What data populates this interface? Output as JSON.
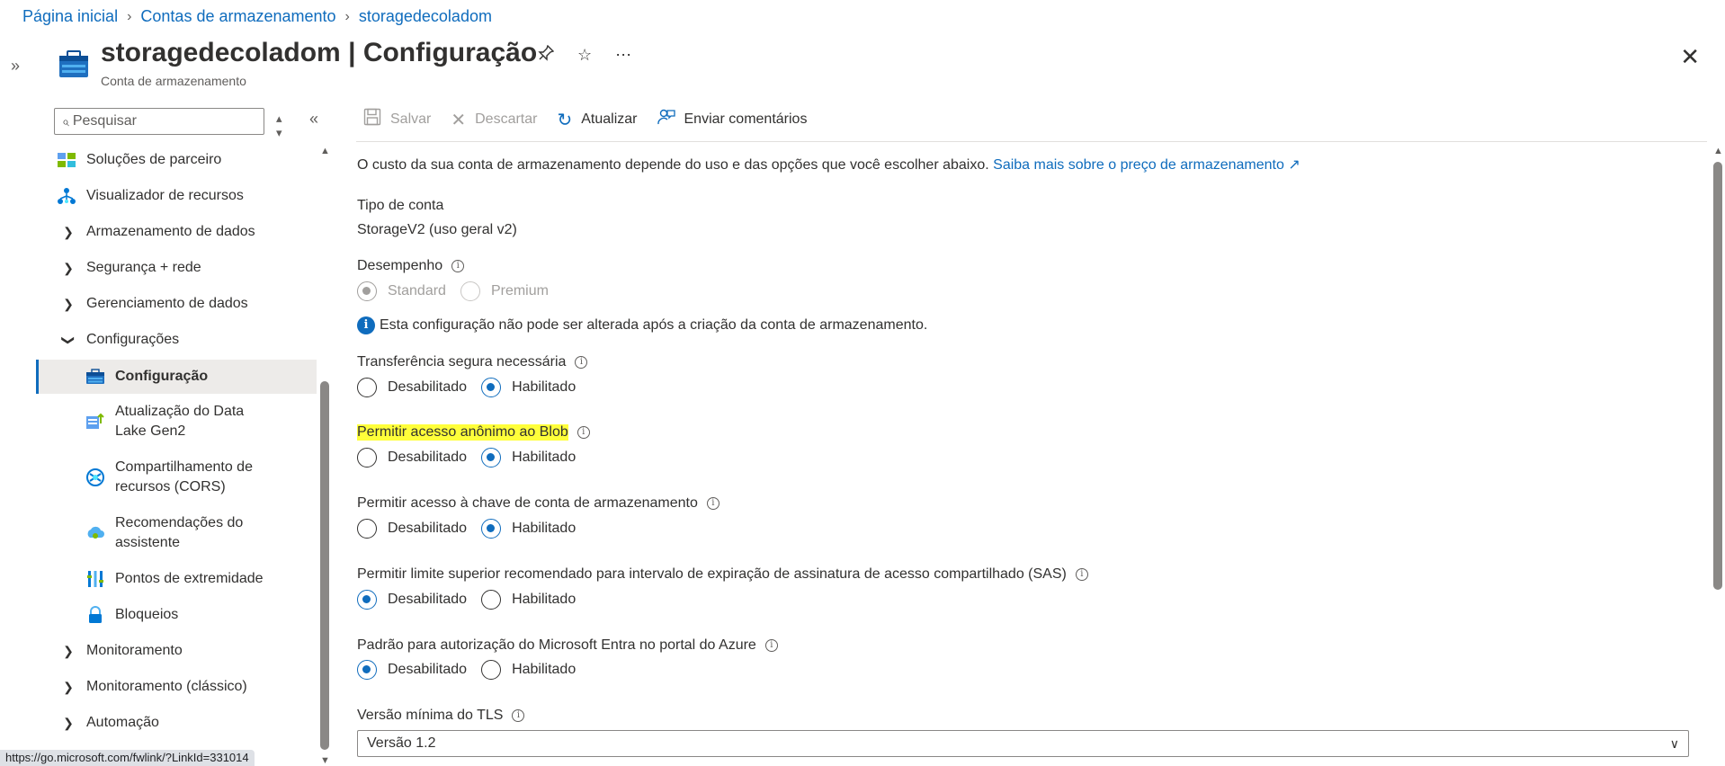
{
  "breadcrumb": [
    "Página inicial",
    "Contas de armazenamento",
    "storagedecoladom"
  ],
  "header": {
    "resource_name": "storagedecoladom",
    "separator": " | ",
    "page_name": "Configuração",
    "subtitle": "Conta de armazenamento"
  },
  "sidebar": {
    "search_placeholder": "Pesquisar",
    "items": [
      {
        "label": "Soluções de parceiro",
        "icon": "partner-solutions-icon"
      },
      {
        "label": "Visualizador de recursos",
        "icon": "resource-visualizer-icon"
      },
      {
        "label": "Armazenamento de dados",
        "expandable": true
      },
      {
        "label": "Segurança + rede",
        "expandable": true
      },
      {
        "label": "Gerenciamento de dados",
        "expandable": true
      },
      {
        "label": "Configurações",
        "expandable": true,
        "expanded": true
      }
    ],
    "sub_items": [
      {
        "label": "Configuração",
        "icon": "configuration-icon",
        "active": true
      },
      {
        "label": "Atualização do Data Lake Gen2",
        "icon": "data-lake-icon"
      },
      {
        "label": "Compartilhamento de recursos (CORS)",
        "icon": "cors-icon"
      },
      {
        "label": "Recomendações do assistente",
        "icon": "advisor-icon"
      },
      {
        "label": "Pontos de extremidade",
        "icon": "endpoints-icon"
      },
      {
        "label": "Bloqueios",
        "icon": "lock-icon"
      }
    ],
    "bottom_items": [
      {
        "label": "Monitoramento",
        "expandable": true
      },
      {
        "label": "Monitoramento (clássico)",
        "expandable": true
      },
      {
        "label": "Automação",
        "expandable": true
      }
    ]
  },
  "status_url": "https://go.microsoft.com/fwlink/?LinkId=331014",
  "toolbar": {
    "save": "Salvar",
    "discard": "Descartar",
    "refresh": "Atualizar",
    "feedback": "Enviar comentários"
  },
  "main": {
    "intro": "O custo da sua conta de armazenamento depende do uso e das opções que você escolher abaixo.",
    "pricing_link": "Saiba mais sobre o preço de armazenamento",
    "account_kind_label": "Tipo de conta",
    "account_kind_value": "StorageV2 (uso geral v2)",
    "performance_label": "Desempenho",
    "performance_options": [
      "Standard",
      "Premium"
    ],
    "performance_selected": "Standard",
    "performance_notice": "Esta configuração não pode ser alterada após a criação da conta de armazenamento.",
    "settings": [
      {
        "label": "Transferência segura necessária",
        "options": [
          "Desabilitado",
          "Habilitado"
        ],
        "selected": "Habilitado"
      },
      {
        "label": "Permitir acesso anônimo ao Blob",
        "options": [
          "Desabilitado",
          "Habilitado"
        ],
        "selected": "Habilitado",
        "highlight_color": "#ffff3a"
      },
      {
        "label": "Permitir acesso à chave de conta de armazenamento",
        "options": [
          "Desabilitado",
          "Habilitado"
        ],
        "selected": "Habilitado"
      },
      {
        "label": "Permitir limite superior recomendado para intervalo de expiração de assinatura de acesso compartilhado (SAS)",
        "options": [
          "Desabilitado",
          "Habilitado"
        ],
        "selected": "Desabilitado"
      },
      {
        "label": "Padrão para autorização do Microsoft Entra no portal do Azure",
        "options": [
          "Desabilitado",
          "Habilitado"
        ],
        "selected": "Desabilitado"
      }
    ],
    "tls_label": "Versão mínima do TLS",
    "tls_value": "Versão 1.2"
  },
  "colors": {
    "accent": "#0f6cbd",
    "highlight": "#ffff3a"
  }
}
